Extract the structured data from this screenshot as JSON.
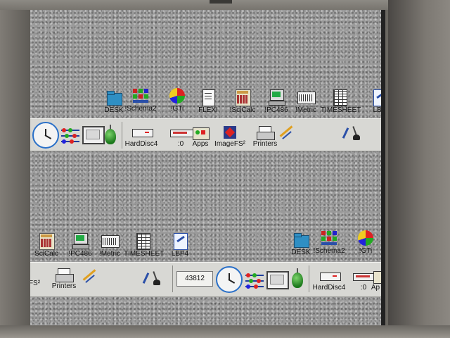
{
  "top_desktop": {
    "icons": [
      {
        "label": "DESK",
        "icon": "folder-icon",
        "name": "desktop-icon-desk"
      },
      {
        "label": "!Schema2",
        "icon": "schema-icon",
        "name": "desktop-icon-schema2"
      },
      {
        "label": "!GTi",
        "icon": "pie-chart-icon",
        "name": "desktop-icon-gti"
      },
      {
        "label": "FLEXI",
        "icon": "document-icon",
        "name": "desktop-icon-flexi"
      },
      {
        "label": "!SciCalc",
        "icon": "calculator-icon",
        "name": "desktop-icon-scicalc"
      },
      {
        "label": "!PC486",
        "icon": "pc-icon",
        "name": "desktop-icon-pc486"
      },
      {
        "label": "!Metric",
        "icon": "ruler-icon",
        "name": "desktop-icon-metric"
      },
      {
        "label": "TIMESHEET",
        "icon": "sheet-icon",
        "name": "desktop-icon-timesheet"
      },
      {
        "label": "LBP",
        "icon": "lbp-icon",
        "name": "desktop-icon-lbp"
      }
    ]
  },
  "top_iconbar": {
    "left_icons": [
      {
        "icon": "clock-icon"
      },
      {
        "icon": "abacus-icon"
      },
      {
        "icon": "monitor-icon"
      },
      {
        "icon": "acorn-icon"
      }
    ],
    "items": [
      {
        "label": "HardDisc4",
        "icon": "hard-disc-icon"
      },
      {
        "label": ":0",
        "icon": "floppy-icon"
      },
      {
        "label": "Apps",
        "icon": "apps-icon"
      },
      {
        "label": "ImageFS²",
        "icon": "imagefs-icon"
      },
      {
        "label": "Printers",
        "icon": "printer-icon"
      }
    ],
    "right_icons": [
      {
        "icon": "draw-icon"
      },
      {
        "icon": "pen-ink-icon"
      }
    ]
  },
  "bottom_desktop": {
    "icons_left": [
      {
        "label": "SciCalc",
        "icon": "calculator-icon"
      },
      {
        "label": "!PC486",
        "icon": "pc-icon"
      },
      {
        "label": "!Metric",
        "icon": "ruler-icon"
      },
      {
        "label": "TIMESHEET",
        "icon": "sheet-icon"
      },
      {
        "label": "LBP4",
        "icon": "lbp-icon"
      }
    ],
    "icons_right": [
      {
        "label": "DESK",
        "icon": "folder-icon"
      },
      {
        "label": "!Schema2",
        "icon": "schema-icon"
      },
      {
        "label": "!GTi",
        "icon": "pie-chart-icon"
      }
    ]
  },
  "bottom_iconbar": {
    "items_left": [
      {
        "label": "FS²",
        "icon": "imagefs-icon"
      },
      {
        "label": "Printers",
        "icon": "printer-icon"
      }
    ],
    "counter": "43812",
    "items_right": [
      {
        "label": "HardDisc4",
        "icon": "hard-disc-icon"
      },
      {
        "label": ":0",
        "icon": "floppy-icon"
      },
      {
        "label": "Ap",
        "icon": "apps-icon"
      }
    ]
  },
  "colors": {
    "iconbar_bg": "#d8d8d4",
    "accent_blue": "#2a70c8",
    "acorn_green": "#2a9a2a"
  }
}
